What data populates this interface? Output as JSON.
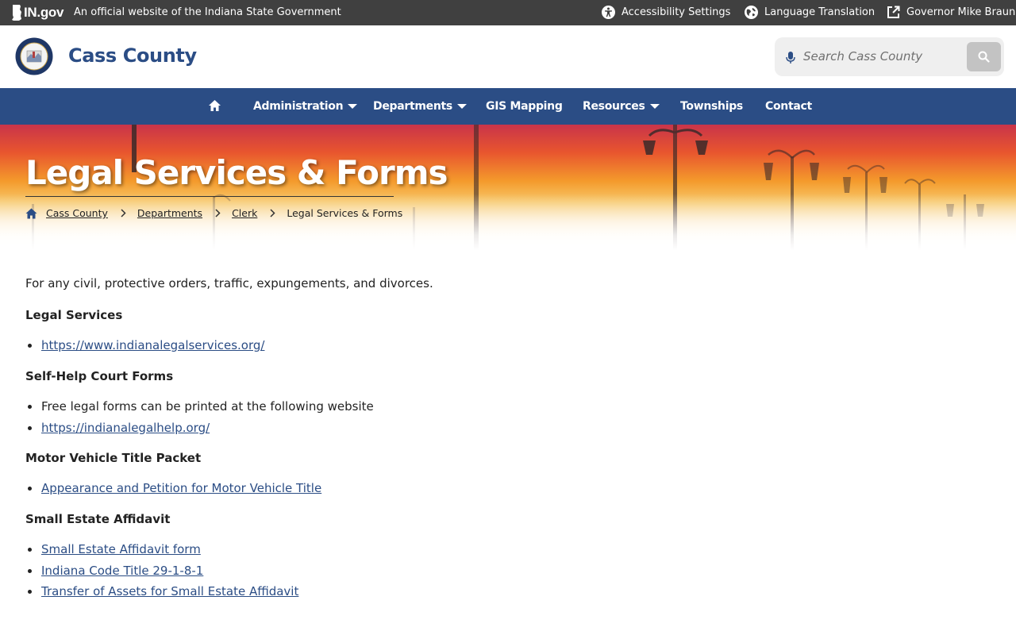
{
  "topbar": {
    "logo_text": "IN.gov",
    "official_text": "An official website of the Indiana State Government",
    "accessibility_label": "Accessibility Settings",
    "language_label": "Language Translation",
    "governor_label": "Governor Mike Braun"
  },
  "header": {
    "site_title": "Cass County",
    "search_placeholder": "Search Cass County"
  },
  "nav": {
    "items": [
      {
        "label": "Administration"
      },
      {
        "label": "Departments"
      },
      {
        "label": "GIS Mapping"
      },
      {
        "label": "Resources"
      },
      {
        "label": "Townships"
      },
      {
        "label": "Contact"
      }
    ]
  },
  "hero": {
    "title": "Legal Services & Forms",
    "breadcrumb": [
      "Cass County",
      "Departments",
      "Clerk",
      "Legal Services & Forms"
    ]
  },
  "content": {
    "intro": "For any civil, protective orders, traffic, expungements, and divorces.",
    "sections": [
      {
        "heading": "Legal Services",
        "items": [
          "https://www.indianalegalservices.org/"
        ]
      },
      {
        "heading": "Self-Help Court Forms",
        "items": [
          "Free legal forms can be printed at the following website",
          "https://indianalegalhelp.org/"
        ]
      },
      {
        "heading": "Motor Vehicle Title Packet",
        "items": [
          "Appearance and Petition for Motor Vehicle Title"
        ]
      },
      {
        "heading": "Small Estate Affidavit",
        "items": [
          "Small Estate Affidavit form",
          "Indiana Code Title 29-1-8-1",
          "Transfer of Assets for Small Estate Affidavit"
        ]
      }
    ]
  },
  "colors": {
    "topbar": "#404040",
    "brand_blue": "#2b4d85",
    "search_bg": "#efefef",
    "search_button": "#c3c3c3"
  },
  "icons": {
    "accessibility": "accessibility-icon",
    "language": "globe-icon",
    "governor": "external-link-icon",
    "microphone": "microphone-icon",
    "search": "search-icon",
    "home": "home-icon",
    "breadcrumb_separator": "chevron-right-icon"
  }
}
